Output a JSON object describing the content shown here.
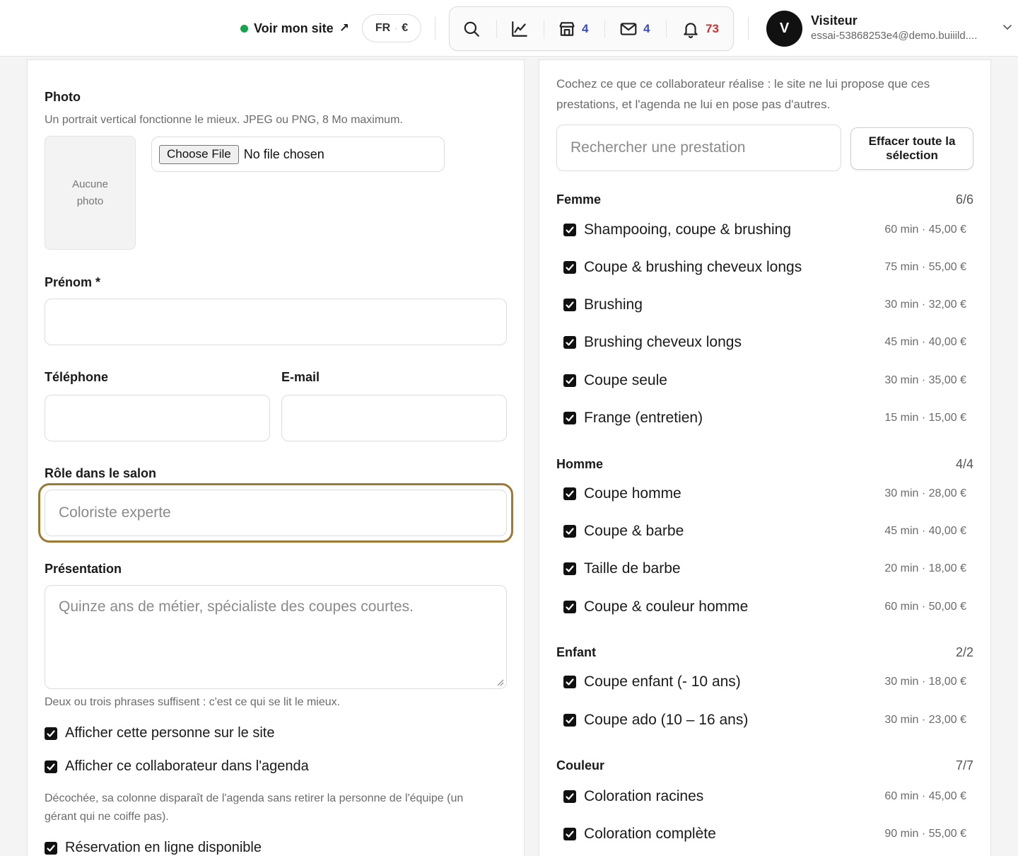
{
  "header": {
    "site_link": "Voir mon site",
    "site_link_arrow": "↗",
    "lang": "FR",
    "lang_sep": "·",
    "currency": "€",
    "tools": {
      "shop_count": "4",
      "messages_count": "4",
      "notifications_count": "73"
    },
    "user": {
      "initial": "V",
      "name": "Visiteur",
      "email": "essai-53868253e4@demo.buiiild...."
    }
  },
  "form": {
    "photo": {
      "label": "Photo",
      "help": "Un portrait vertical fonctionne le mieux. JPEG ou PNG, 8 Mo maximum.",
      "placeholder": "Aucune photo",
      "file_button": "Choose File",
      "file_status": "No file chosen"
    },
    "first_name": {
      "label": "Prénom *",
      "value": ""
    },
    "phone": {
      "label": "Téléphone",
      "value": ""
    },
    "email": {
      "label": "E-mail",
      "value": ""
    },
    "role": {
      "label": "Rôle dans le salon",
      "placeholder": "Coloriste experte"
    },
    "bio": {
      "label": "Présentation",
      "placeholder": "Quinze ans de métier, spécialiste des coupes courtes.",
      "help": "Deux ou trois phrases suffisent : c'est ce qui se lit le mieux."
    },
    "options": [
      {
        "label": "Afficher cette personne sur le site",
        "checked": true
      },
      {
        "label": "Afficher ce collaborateur dans l'agenda",
        "checked": true
      },
      {
        "label": "Réservation en ligne disponible",
        "checked": true
      }
    ],
    "agenda_help": "Décochée, sa colonne disparaît de l'agenda sans retirer la personne de l'équipe (un gérant qui ne coiffe pas)."
  },
  "services": {
    "intro": "Cochez ce que ce collaborateur réalise : le site ne lui propose que ces prestations, et l'agenda ne lui en pose pas d'autres.",
    "search_placeholder": "Rechercher une prestation",
    "clear_button": "Effacer toute la sélection",
    "categories": [
      {
        "name": "Femme",
        "count": "6/6",
        "items": [
          {
            "name": "Shampooing, coupe & brushing",
            "meta": "60 min · 45,00 €",
            "checked": true
          },
          {
            "name": "Coupe & brushing cheveux longs",
            "meta": "75 min · 55,00 €",
            "checked": true
          },
          {
            "name": "Brushing",
            "meta": "30 min · 32,00 €",
            "checked": true
          },
          {
            "name": "Brushing cheveux longs",
            "meta": "45 min · 40,00 €",
            "checked": true
          },
          {
            "name": "Coupe seule",
            "meta": "30 min · 35,00 €",
            "checked": true
          },
          {
            "name": "Frange (entretien)",
            "meta": "15 min · 15,00 €",
            "checked": true
          }
        ]
      },
      {
        "name": "Homme",
        "count": "4/4",
        "items": [
          {
            "name": "Coupe homme",
            "meta": "30 min · 28,00 €",
            "checked": true
          },
          {
            "name": "Coupe & barbe",
            "meta": "45 min · 40,00 €",
            "checked": true
          },
          {
            "name": "Taille de barbe",
            "meta": "20 min · 18,00 €",
            "checked": true
          },
          {
            "name": "Coupe & couleur homme",
            "meta": "60 min · 50,00 €",
            "checked": true
          }
        ]
      },
      {
        "name": "Enfant",
        "count": "2/2",
        "items": [
          {
            "name": "Coupe enfant (- 10 ans)",
            "meta": "30 min · 18,00 €",
            "checked": true
          },
          {
            "name": "Coupe ado (10 – 16 ans)",
            "meta": "30 min · 23,00 €",
            "checked": true
          }
        ]
      },
      {
        "name": "Couleur",
        "count": "7/7",
        "items": [
          {
            "name": "Coloration racines",
            "meta": "60 min · 45,00 €",
            "checked": true
          },
          {
            "name": "Coloration complète",
            "meta": "90 min · 55,00 €",
            "checked": true
          }
        ]
      }
    ]
  }
}
